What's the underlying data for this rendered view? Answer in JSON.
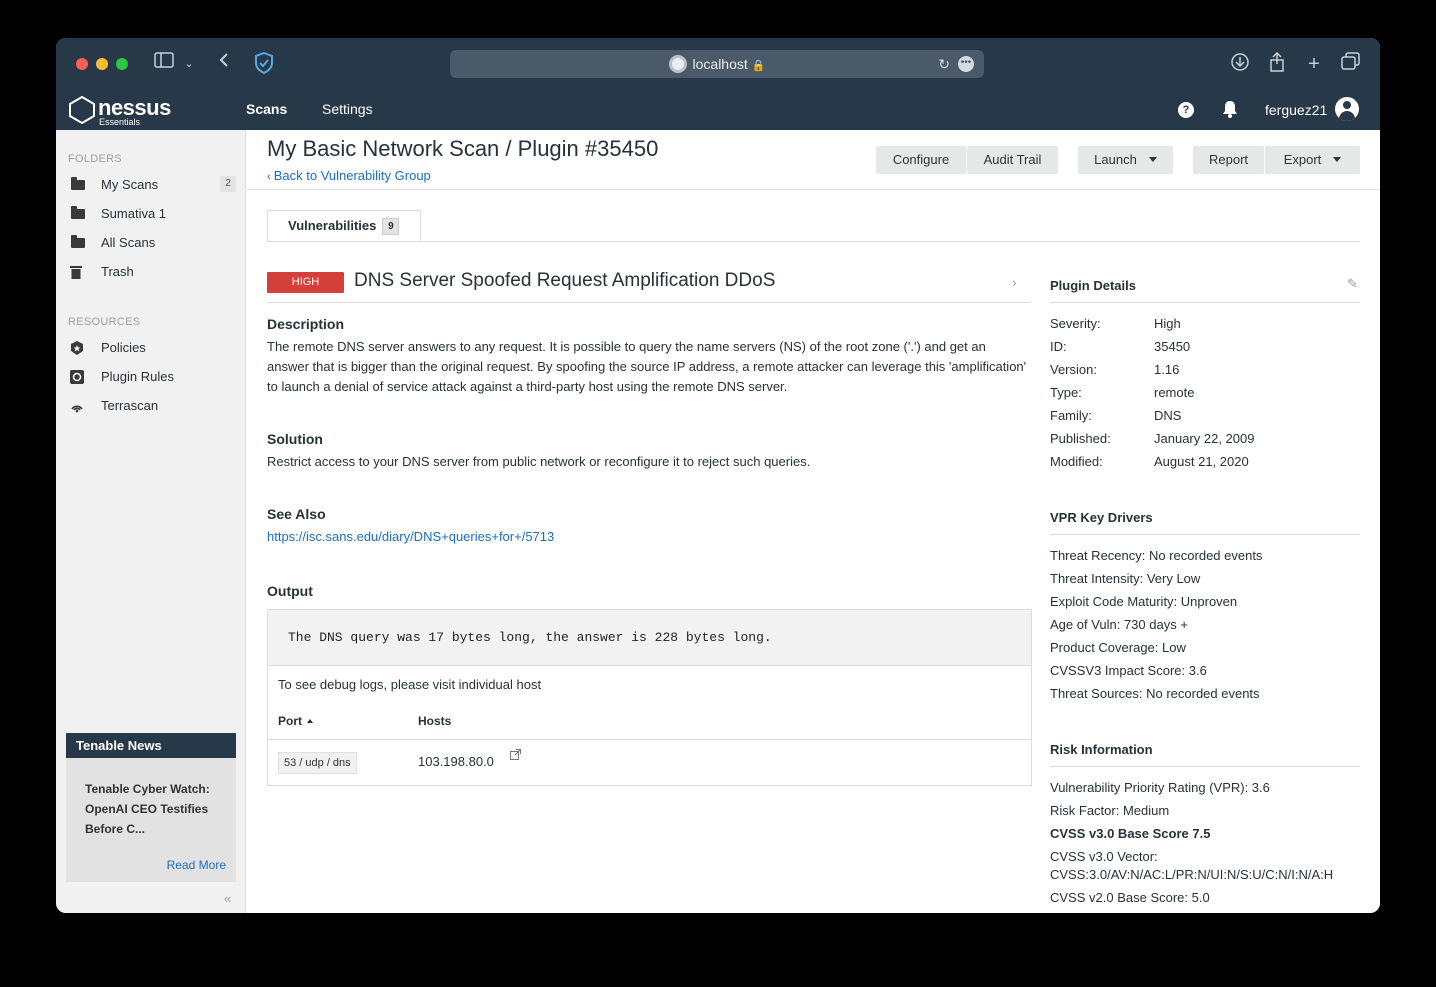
{
  "browser": {
    "url": "localhost"
  },
  "app": {
    "logo_name": "nessus",
    "logo_sub": "Essentials",
    "nav": {
      "scans": "Scans",
      "settings": "Settings"
    },
    "help": "?",
    "username": "ferguez21"
  },
  "sidebar": {
    "folders_heading": "FOLDERS",
    "folders": [
      {
        "label": "My Scans",
        "count": "2"
      },
      {
        "label": "Sumativa 1"
      },
      {
        "label": "All Scans"
      },
      {
        "label": "Trash"
      }
    ],
    "resources_heading": "RESOURCES",
    "resources": [
      {
        "label": "Policies"
      },
      {
        "label": "Plugin Rules"
      },
      {
        "label": "Terrascan"
      }
    ],
    "news": {
      "heading": "Tenable News",
      "text": "Tenable Cyber Watch: OpenAI CEO Testifies Before C...",
      "link": "Read More"
    }
  },
  "header": {
    "title": "My Basic Network Scan / Plugin #35450",
    "back_link": "Back to Vulnerability Group",
    "buttons": {
      "configure": "Configure",
      "audit_trail": "Audit Trail",
      "launch": "Launch",
      "report": "Report",
      "export": "Export"
    }
  },
  "tabs": [
    {
      "label": "Vulnerabilities",
      "count": "9"
    }
  ],
  "vulnerability": {
    "severity": "HIGH",
    "severity_color": "#d43f3a",
    "title": "DNS Server Spoofed Request Amplification DDoS",
    "description_heading": "Description",
    "description": "The remote DNS server answers to any request. It is possible to query the name servers (NS) of the root zone ('.') and get an answer that is bigger than the original request. By spoofing the source IP address, a remote attacker can leverage this 'amplification' to launch a denial of service attack against a third-party host using the remote DNS server.",
    "solution_heading": "Solution",
    "solution": "Restrict access to your DNS server from public network or reconfigure it to reject such queries.",
    "see_also_heading": "See Also",
    "see_also": "https://isc.sans.edu/diary/DNS+queries+for+/5713",
    "output_heading": "Output",
    "output_text": "The DNS query was 17 bytes long, the answer is 228 bytes long.",
    "debug_note": "To see debug logs, please visit individual host",
    "table_headers": {
      "port": "Port",
      "hosts": "Hosts"
    },
    "rows": [
      {
        "port": "53 / udp / dns",
        "host": "103.198.80.0"
      }
    ]
  },
  "plugin_details": {
    "heading": "Plugin Details",
    "items": [
      {
        "key": "Severity:",
        "value": "High"
      },
      {
        "key": "ID:",
        "value": "35450"
      },
      {
        "key": "Version:",
        "value": "1.16"
      },
      {
        "key": "Type:",
        "value": "remote"
      },
      {
        "key": "Family:",
        "value": "DNS"
      },
      {
        "key": "Published:",
        "value": "January 22, 2009"
      },
      {
        "key": "Modified:",
        "value": "August 21, 2020"
      }
    ]
  },
  "vpr": {
    "heading": "VPR Key Drivers",
    "items": [
      "Threat Recency: No recorded events",
      "Threat Intensity: Very Low",
      "Exploit Code Maturity: Unproven",
      "Age of Vuln: 730 days +",
      "Product Coverage: Low",
      "CVSSV3 Impact Score: 3.6",
      "Threat Sources: No recorded events"
    ]
  },
  "risk": {
    "heading": "Risk Information",
    "items": [
      "Vulnerability Priority Rating (VPR): 3.6",
      "Risk Factor: Medium",
      "CVSS v3.0 Base Score 7.5",
      "CVSS v3.0 Vector:",
      "CVSS:3.0/AV:N/AC:L/PR:N/UI:N/S:U/C:N/I:N/A:H",
      "CVSS v2.0 Base Score: 5.0"
    ]
  }
}
